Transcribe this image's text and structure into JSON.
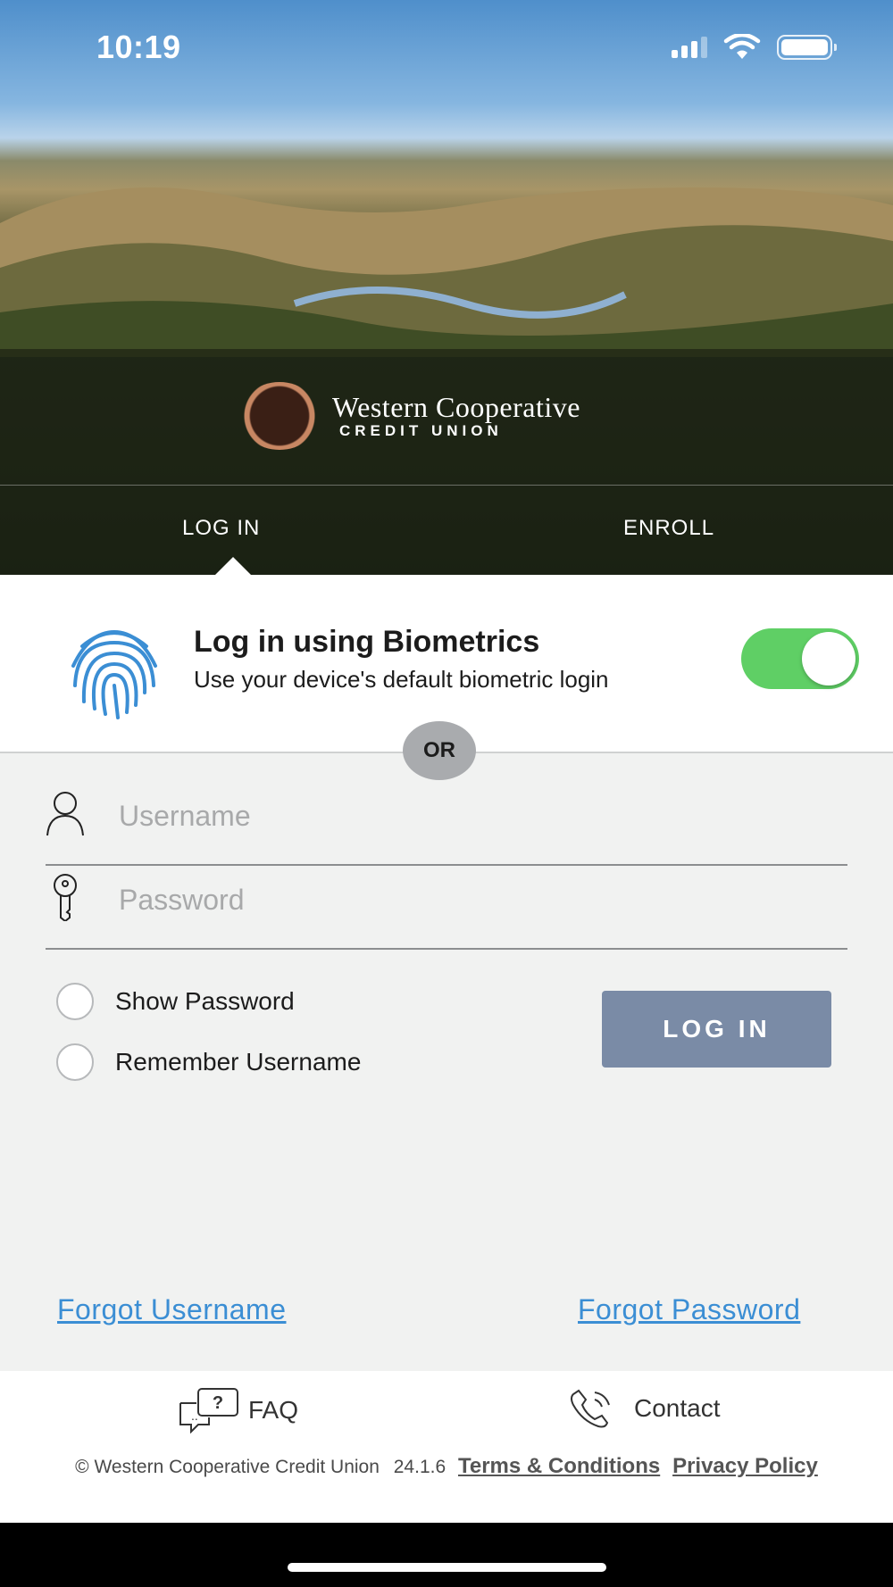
{
  "status_bar": {
    "time": "10:19"
  },
  "brand": {
    "name_line1": "Western Cooperative",
    "name_line2": "CREDIT UNION"
  },
  "tabs": [
    {
      "label": "LOG IN",
      "active": true
    },
    {
      "label": "ENROLL",
      "active": false
    }
  ],
  "biometrics": {
    "title": "Log in using Biometrics",
    "subtitle": "Use your device's default biometric login",
    "enabled": true,
    "icon": "fingerprint-icon"
  },
  "divider": {
    "label": "OR"
  },
  "form": {
    "username": {
      "placeholder": "Username",
      "value": ""
    },
    "password": {
      "placeholder": "Password",
      "value": ""
    },
    "show_password_label": "Show Password",
    "remember_username_label": "Remember Username",
    "login_button": "LOG IN"
  },
  "links": {
    "forgot_username": "Forgot Username",
    "forgot_password": "Forgot Password"
  },
  "footer": {
    "faq": "FAQ",
    "contact": "Contact",
    "copyright": "© Western Cooperative Credit Union",
    "version": "24.1.6",
    "terms": "Terms & Conditions",
    "privacy": "Privacy Policy"
  },
  "colors": {
    "toggle_on": "#5fcf65",
    "login_button": "#7a8ba6",
    "link": "#3b8ed4",
    "fingerprint": "#3b8ed4"
  }
}
